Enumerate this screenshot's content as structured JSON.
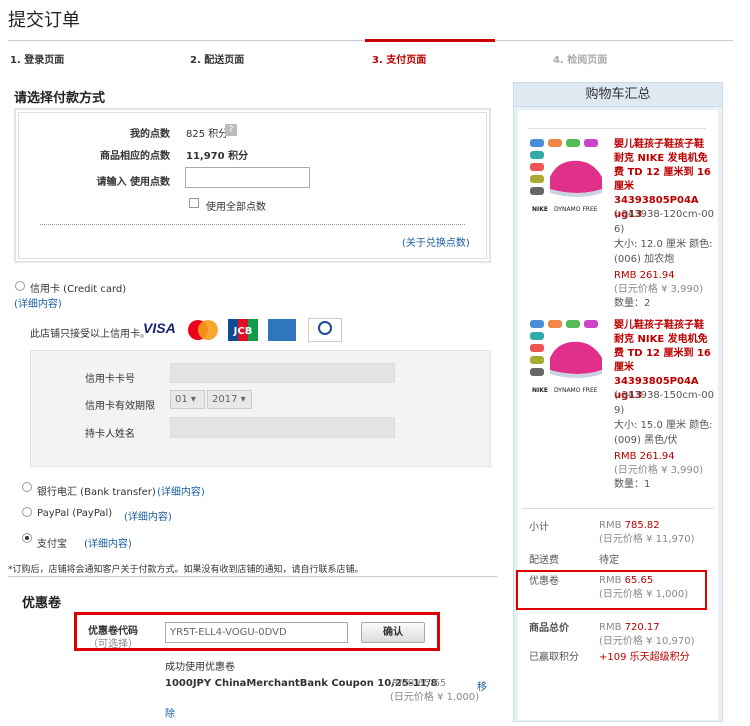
{
  "page_title": "提交订单",
  "steps": [
    "1. 登录页面",
    "2. 配送页面",
    "3. 支付页面",
    "4. 检阅页面"
  ],
  "payment": {
    "heading": "请选择付款方式",
    "my_points_label": "我的点数",
    "my_points_value": "825 积分",
    "product_points_label": "商品相应的点数",
    "product_points_value": "11,970 积分",
    "use_points_label": "请输入 使用点数",
    "use_all_label": "使用全部点数",
    "points_link": "(关于兑换点数)",
    "credit_card_label": "信用卡 (Credit card)",
    "detail_link": "(详细内容)",
    "cards_accepted": "此店铺只接受以上信用卡。",
    "card_number_label": "信用卡卡号",
    "card_expiry_label": "信用卡有效期限",
    "expiry_month": "01",
    "expiry_year": "2017",
    "holder_label": "持卡人姓名",
    "bank_label": "银行电汇 (Bank transfer)",
    "bank_link": "(详细内容)",
    "paypal_label": "PayPal (PayPal)",
    "paypal_link": "(详细内容)",
    "alipay_label": "支付宝",
    "alipay_link": "(详细内容)",
    "note": "*订购后，店铺将会通知客户关于付款方式。如果没有收到店铺的通知，请自行联系店铺。"
  },
  "coupon": {
    "heading": "优惠卷",
    "code_label": "优惠卷代码",
    "optional": "（可选择）",
    "code_value": "YR5T-ELL4-VOGU-0DVD",
    "confirm_button": "确认",
    "success_label": "成功使用优惠卷",
    "coupon_name": "1000JPY ChinaMerchantBank Coupon 10/25-11/8",
    "coupon_rmb": "RMB 65.65",
    "coupon_jpy": "(日元价格 ¥ 1,000)",
    "remove_1": "移",
    "remove_2": "除"
  },
  "cart": {
    "heading": "购物车汇总",
    "items": [
      {
        "name_lines": [
          "婴儿鞋孩子鞋孩子鞋",
          "耐克 NIKE 发电机免",
          "费 TD 12 厘米到 16",
          "厘米 34393805P04A",
          "ug13"
        ],
        "detail_lines": [
          "(-343938-120cm-00",
          "6)",
          "大小: 12.0 厘米 颜色:",
          "(006) 加农炮"
        ],
        "rmb": "RMB 261.94",
        "jpy": "(日元价格 ¥ 3,990)",
        "qty": "数量：2"
      },
      {
        "name_lines": [
          "婴儿鞋孩子鞋孩子鞋",
          "耐克 NIKE 发电机免",
          "费 TD 12 厘米到 16",
          "厘米 34393805P04A",
          "ug13"
        ],
        "detail_lines": [
          "(-343938-150cm-00",
          "9)",
          "大小: 15.0 厘米 颜色:",
          "(009) 黑色/伏"
        ],
        "rmb": "RMB 261.94",
        "jpy": "(日元价格 ¥ 3,990)",
        "qty": "数量：1"
      }
    ],
    "subtotal_label": "小计",
    "subtotal_rmb": "RMB 785.82",
    "subtotal_jpy": "(日元价格 ¥ 11,970)",
    "shipping_label": "配送费",
    "shipping_value": "待定",
    "coupon_label": "优惠卷",
    "coupon_rmb": "RMB 65.65",
    "coupon_jpy": "(日元价格 ¥ 1,000)",
    "total_label": "商品总价",
    "total_rmb": "RMB 720.17",
    "total_jpy": "(日元价格 ¥ 10,970)",
    "earned_label": "已赢取积分",
    "earned_value": "+109 乐天超级积分",
    "shoe_brand": "DYNAMO FREE"
  }
}
